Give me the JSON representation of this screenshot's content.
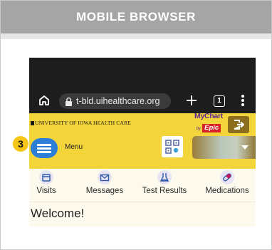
{
  "header": {
    "title": "MOBILE BROWSER"
  },
  "browser": {
    "url": "t-bld.uihealthcare.org",
    "tab_count": "1",
    "icons": {
      "home": "home-icon",
      "lock": "lock-icon",
      "new_tab": "plus-icon",
      "tabs": "tabs-icon",
      "menu": "kebab-menu-icon"
    }
  },
  "app": {
    "org_name": "UNIVERSITY OF IOWA HEALTH CARE",
    "brand": {
      "name": "MyChart",
      "by": "by",
      "vendor": "Epic"
    },
    "menu_label": "Menu",
    "step_badge": "3",
    "colors": {
      "accent": "#f3d43b",
      "menu_button": "#2d7ed6",
      "logout": "#8a6e1d",
      "badge": "#f5c518",
      "nav_bg": "#fdf9ec"
    },
    "nav": [
      {
        "label": "Visits",
        "icon": "calendar-icon"
      },
      {
        "label": "Messages",
        "icon": "envelope-icon"
      },
      {
        "label": "Test Results",
        "icon": "flask-icon"
      },
      {
        "label": "Medications",
        "icon": "pill-icon"
      }
    ],
    "welcome": "Welcome!"
  }
}
